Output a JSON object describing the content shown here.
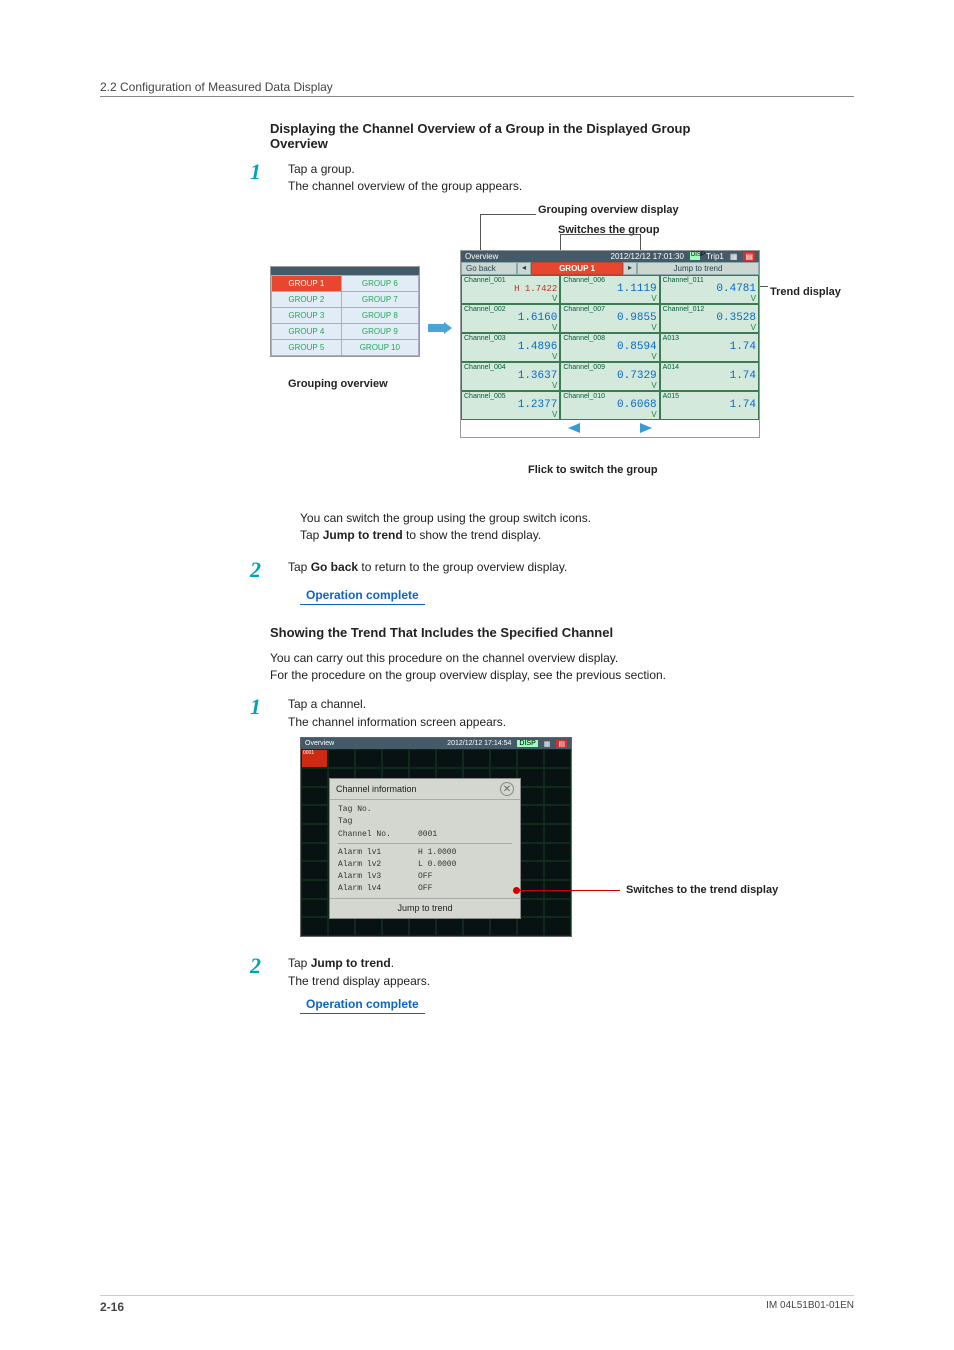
{
  "header": {
    "section": "2.2  Configuration of Measured Data Display"
  },
  "h1": "Displaying the Channel Overview of a Group in the Displayed Group Overview",
  "steps_a": {
    "s1_line1": "Tap a group.",
    "s1_line2": "The channel overview of the group appears.",
    "after": "You can switch the group using the group switch icons.",
    "after2_pre": "Tap ",
    "after2_bold": "Jump to trend",
    "after2_post": " to show the trend display.",
    "s2_pre": "Tap ",
    "s2_bold": "Go back",
    "s2_post": " to return to the group overview display."
  },
  "op_complete": "Operation complete",
  "labels": {
    "grouping_overview_display": "Grouping overview display",
    "switches_the_group": "Switches the group",
    "trend_display": "Trend display",
    "grouping_overview": "Grouping overview",
    "flick": "Flick to switch the group",
    "switches_trend": "Switches to the trend display"
  },
  "group_overview": {
    "rows": [
      [
        "GROUP 1",
        "GROUP 6"
      ],
      [
        "GROUP 2",
        "GROUP 7"
      ],
      [
        "GROUP 3",
        "GROUP 8"
      ],
      [
        "GROUP 4",
        "GROUP 9"
      ],
      [
        "GROUP 5",
        "GROUP 10"
      ]
    ]
  },
  "channel_overview": {
    "topbar_title": "Overview",
    "topbar_time": "2012/12/12 17:01:30",
    "disp": "DISP",
    "trip": "Trip1",
    "go_back": "Go back",
    "group_name": "GROUP 1",
    "jump_to_trend": "Jump to trend",
    "channels": [
      {
        "name": "Channel_001",
        "hl": "H 1.7422",
        "val": "",
        "unit": "V"
      },
      {
        "name": "Channel_006",
        "val": "1.1119",
        "unit": "V"
      },
      {
        "name": "Channel_011",
        "val": "0.4781",
        "unit": "V"
      },
      {
        "name": "Channel_002",
        "val": "1.6160",
        "unit": "V"
      },
      {
        "name": "Channel_007",
        "val": "0.9855",
        "unit": "V"
      },
      {
        "name": "Channel_012",
        "val": "0.3528",
        "unit": "V"
      },
      {
        "name": "Channel_003",
        "val": "1.4896",
        "unit": "V"
      },
      {
        "name": "Channel_008",
        "val": "0.8594",
        "unit": "V"
      },
      {
        "name": "A013",
        "val": "1.74",
        "unit": ""
      },
      {
        "name": "Channel_004",
        "val": "1.3637",
        "unit": "V"
      },
      {
        "name": "Channel_009",
        "val": "0.7329",
        "unit": "V"
      },
      {
        "name": "A014",
        "val": "1.74",
        "unit": ""
      },
      {
        "name": "Channel_005",
        "val": "1.2377",
        "unit": "V"
      },
      {
        "name": "Channel_010",
        "val": "0.6068",
        "unit": "V"
      },
      {
        "name": "A015",
        "val": "1.74",
        "unit": ""
      }
    ]
  },
  "h2": "Showing the Trend That Includes the Specified Channel",
  "p2a": "You can carry out this procedure on the channel overview display.",
  "p2b": "For the procedure on the group overview display, see the previous section.",
  "steps_b": {
    "s1_line1": "Tap a channel.",
    "s1_line2": "The channel information screen appears.",
    "s2_pre": "Tap ",
    "s2_bold": "Jump to trend",
    "s2_post": ".",
    "s2_line2": "The trend display appears."
  },
  "channel_info": {
    "topbar_title": "Overview",
    "topbar_time": "2012/12/12 17:14:54",
    "disp": "DISP",
    "popup_title": "Channel information",
    "rows": [
      [
        "Tag No.",
        ""
      ],
      [
        "Tag",
        ""
      ],
      [
        "Channel No.",
        "0001"
      ]
    ],
    "alarms": [
      [
        "Alarm lv1",
        "H 1.0000"
      ],
      [
        "Alarm lv2",
        "L 0.0000"
      ],
      [
        "Alarm lv3",
        "OFF"
      ],
      [
        "Alarm lv4",
        "OFF"
      ]
    ],
    "jump": "Jump to trend"
  },
  "footer": {
    "page": "2-16",
    "doc": "IM 04L51B01-01EN"
  }
}
